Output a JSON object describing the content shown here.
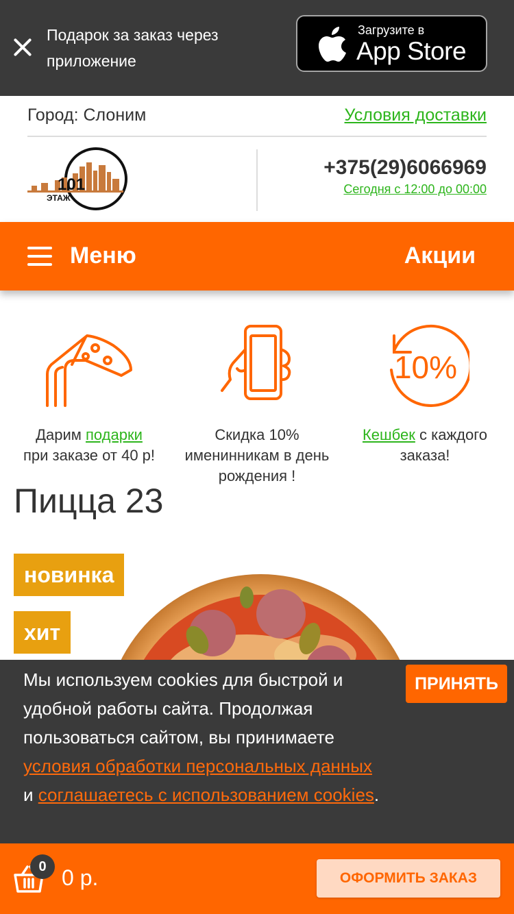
{
  "app_banner": {
    "promo_text": "Подарок за заказ через приложение",
    "store_small_label": "Загрузите в",
    "store_big_label": "App Store"
  },
  "header": {
    "city_label": "Город: Слоним",
    "delivery_link": "Условия доставки",
    "phone": "+375(29)6066969",
    "hours": "Сегодня с 12:00 до 00:00"
  },
  "logo": {
    "number": "101",
    "name": "ЭТАЖ"
  },
  "nav": {
    "menu_label": "Меню",
    "promo_label": "Акции"
  },
  "features": [
    {
      "icon": "pizza-slice-icon",
      "text_before": "Дарим ",
      "link": "подарки",
      "text_after": "при заказе от 40 р!"
    },
    {
      "icon": "phone-in-hand-icon",
      "text": "Скидка 10% именинникам в день рождения !"
    },
    {
      "icon": "cashback-percent-icon",
      "icon_text": "10%",
      "link": "Кешбек",
      "text_after": " с каждого заказа!"
    }
  ],
  "product": {
    "title": "Пицца 23",
    "badges": [
      "новинка",
      "хит"
    ]
  },
  "cookie": {
    "text_1": "Мы используем cookies для быстрой и удобной работы сайта. Продолжая пользоваться сайтом, вы принимаете ",
    "link_1": "условия обработки персональных данных",
    "text_2": " и ",
    "link_2": "соглашаетесь с использованием cookies",
    "text_3": ".",
    "accept_label": "ПРИНЯТЬ"
  },
  "cart": {
    "count": "0",
    "total": "0 р.",
    "checkout_label": "ОФОРМИТЬ ЗАКАЗ"
  },
  "colors": {
    "accent": "#ff6600",
    "link_green": "#2db51c",
    "banner_dark": "#3a3a3a",
    "badge_gold": "#e8a010"
  }
}
